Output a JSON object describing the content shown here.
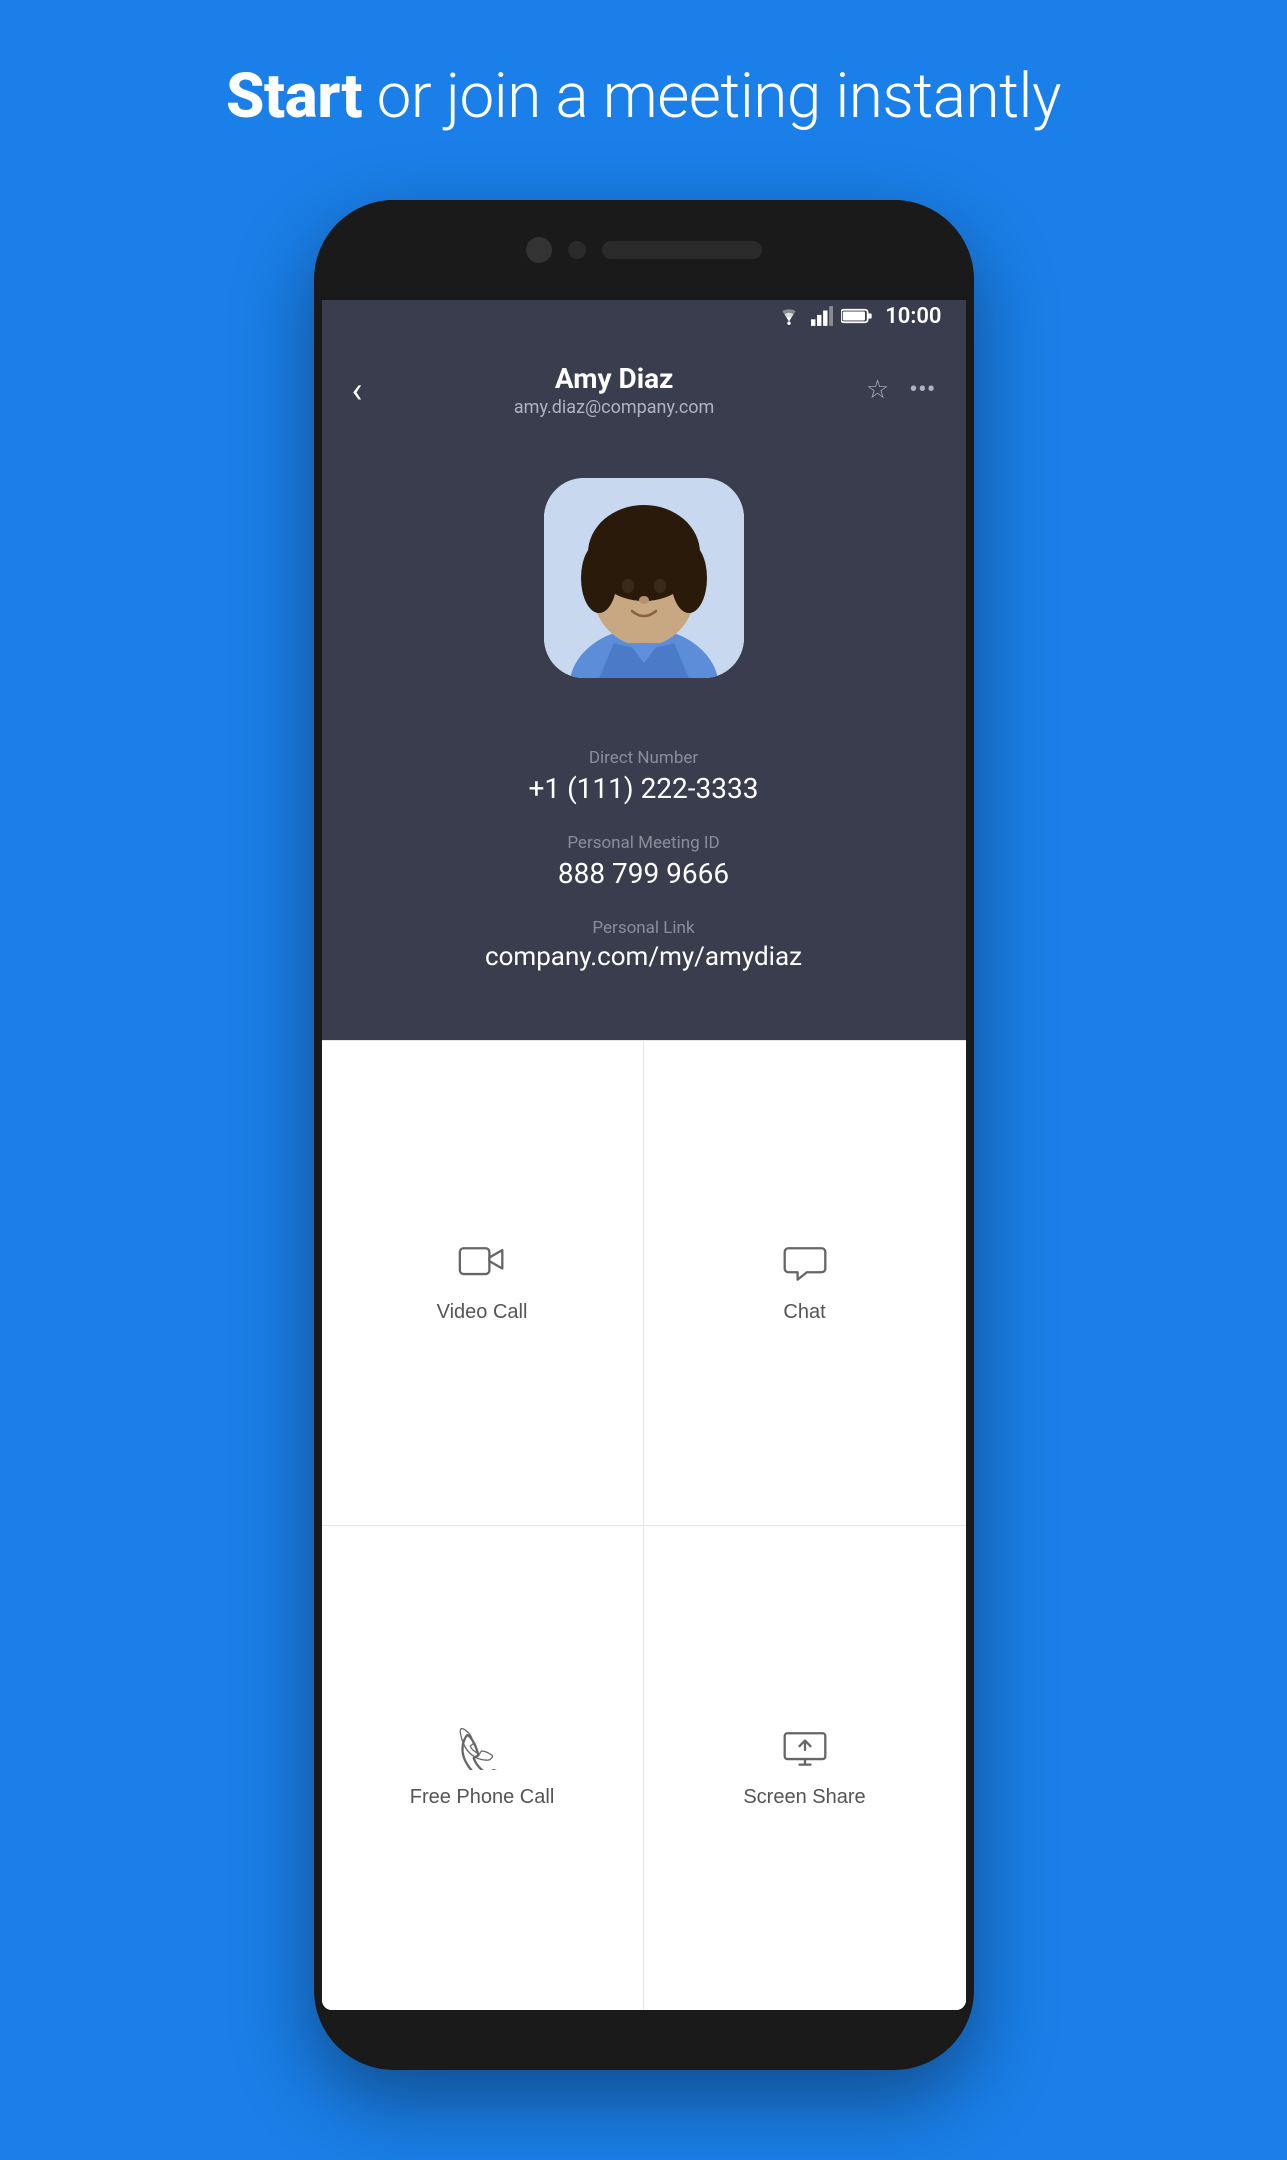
{
  "header": {
    "title_bold": "Start",
    "title_rest": " or join a meeting instantly"
  },
  "status_bar": {
    "time": "10:00"
  },
  "contact": {
    "name": "Amy Diaz",
    "email": "amy.diaz@company.com",
    "direct_number_label": "Direct Number",
    "direct_number": "+1 (111) 222-3333",
    "meeting_id_label": "Personal Meeting ID",
    "meeting_id": "888 799 9666",
    "personal_link_label": "Personal Link",
    "personal_link": "company.com/my/amydiaz"
  },
  "actions": {
    "video_call": "Video Call",
    "chat": "Chat",
    "free_phone_call": "Free Phone Call",
    "screen_share": "Screen Share"
  },
  "colors": {
    "background": "#1a7fe8",
    "screen_bg": "#3a3d4d",
    "action_bg": "#ffffff"
  }
}
